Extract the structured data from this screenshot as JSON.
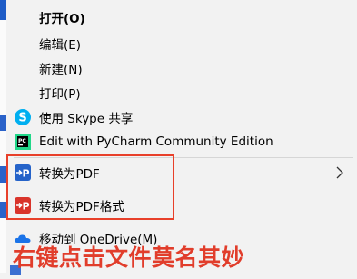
{
  "menu": {
    "items": [
      {
        "label": "打开(O)",
        "bold": true
      },
      {
        "label": "编辑(E)"
      },
      {
        "label": "新建(N)"
      },
      {
        "label": "打印(P)"
      },
      {
        "label": "使用 Skype 共享",
        "icon": "skype-icon"
      },
      {
        "label": "Edit with PyCharm Community Edition",
        "icon": "pycharm-icon"
      },
      {
        "label": "转换为PDF",
        "icon": "pdf-convert-icon",
        "has_submenu": true
      },
      {
        "label": "转换为PDF格式",
        "icon": "pdf-format-icon"
      },
      {
        "label": "移动到 OneDrive(M)",
        "icon": "onedrive-icon"
      }
    ]
  },
  "caption": "右键点击文件莫名其妙",
  "colors": {
    "highlight_box": "#e8402a",
    "caption": "#e13d2b",
    "skype": "#00aff0",
    "pycharm": "#21d789",
    "pdf_blue": "#2563c9",
    "pdf_red": "#d9342b",
    "onedrive": "#1a73e8"
  }
}
